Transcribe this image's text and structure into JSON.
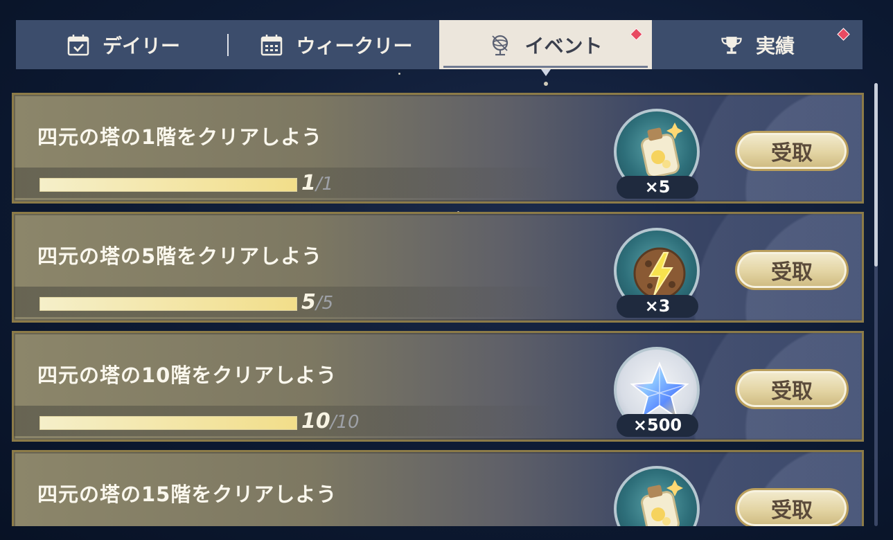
{
  "tabs": {
    "daily": {
      "label": "デイリー",
      "icon": "calendar-check-icon"
    },
    "weekly": {
      "label": "ウィークリー",
      "icon": "calendar-grid-icon"
    },
    "event": {
      "label": "イベント",
      "icon": "globe-compass-icon",
      "active": true,
      "has_badge": true
    },
    "achievements": {
      "label": "実績",
      "icon": "trophy-icon",
      "has_badge": true
    }
  },
  "missions": [
    {
      "title": "四元の塔の1階をクリアしよう",
      "progress": 1,
      "total": 1,
      "progress_text": "1",
      "total_text": "/1",
      "reward_icon": "bottle-reward-icon",
      "reward_qty": "×5",
      "claim_label": "受取"
    },
    {
      "title": "四元の塔の5階をクリアしよう",
      "progress": 5,
      "total": 5,
      "progress_text": "5",
      "total_text": "/5",
      "reward_icon": "lightning-cookie-icon",
      "reward_qty": "×3",
      "claim_label": "受取"
    },
    {
      "title": "四元の塔の10階をクリアしよう",
      "progress": 10,
      "total": 10,
      "progress_text": "10",
      "total_text": "/10",
      "reward_icon": "crystal-star-icon",
      "reward_qty": "×500",
      "claim_label": "受取"
    },
    {
      "title": "四元の塔の15階をクリアしよう",
      "reward_icon": "bottle-reward-icon",
      "claim_label": "受取"
    }
  ],
  "colors": {
    "badge": "#e84a62",
    "tabbar": "#3c4d6c",
    "active_tab": "#ece6dc",
    "progress_fill": "#f2de8a"
  }
}
